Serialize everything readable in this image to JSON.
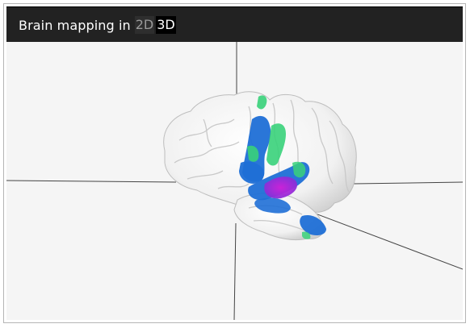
{
  "header": {
    "title": "Brain mapping in",
    "modes": [
      {
        "label": "2D",
        "active": false
      },
      {
        "label": "3D",
        "active": true
      }
    ]
  },
  "colors": {
    "titlebar": "#222222",
    "viewport_bg": "#f5f5f5",
    "axis_lines": "#444444",
    "brain_surface": "#f0f0f0",
    "activation_blue": "#1f6fd6",
    "activation_green": "#39d27a",
    "activation_magenta": "#c41fcf"
  }
}
